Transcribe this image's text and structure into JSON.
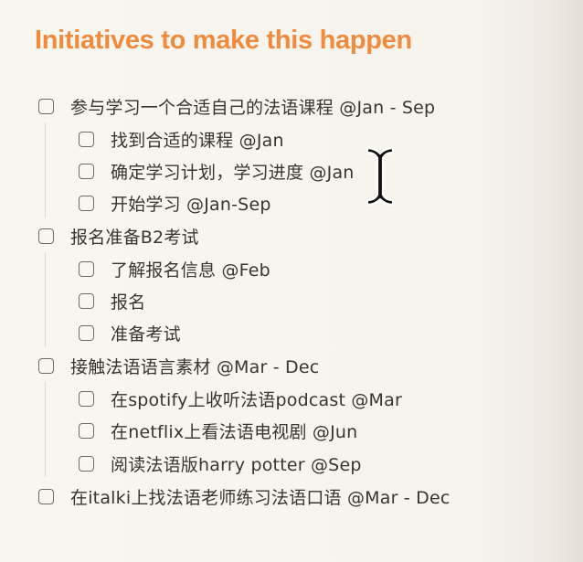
{
  "heading": "Initiatives to make this happen",
  "tasks": [
    {
      "label": "参与学习一个合适自己的法语课程 @Jan - Sep",
      "subtasks": [
        {
          "label": "找到合适的课程 @Jan"
        },
        {
          "label": "确定学习计划，学习进度 @Jan"
        },
        {
          "label": "开始学习 @Jan-Sep"
        }
      ]
    },
    {
      "label": "报名准备B2考试",
      "subtasks": [
        {
          "label": "了解报名信息 @Feb"
        },
        {
          "label": "报名"
        },
        {
          "label": "准备考试"
        }
      ]
    },
    {
      "label": "接触法语语言素材 @Mar - Dec",
      "subtasks": [
        {
          "label": "在spotify上收听法语podcast @Mar"
        },
        {
          "label": "在netflix上看法语电视剧 @Jun"
        },
        {
          "label": "阅读法语版harry potter @Sep"
        }
      ]
    },
    {
      "label": "在italki上找法语老师练习法语口语 @Mar - Dec",
      "subtasks": []
    }
  ],
  "colors": {
    "heading": "#f08a3c",
    "text": "#37352f",
    "checkbox_border": "#6e6a66",
    "background": "#f7f4ee"
  },
  "icons": {
    "cursor": "text-cursor-icon",
    "checkbox": "checkbox-icon"
  }
}
